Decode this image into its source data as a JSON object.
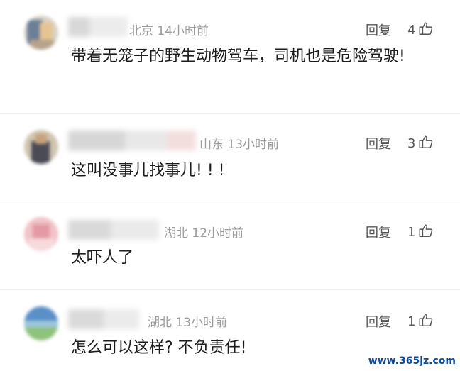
{
  "comments": [
    {
      "location": "北京",
      "time": "14小时前",
      "reply_label": "回复",
      "likes": "4",
      "text": "带着无笼子的野生动物驾车，司机也是危险驾驶!"
    },
    {
      "location": "山东",
      "time": "13小时前",
      "reply_label": "回复",
      "likes": "3",
      "text": "这叫没事儿找事儿! ! !"
    },
    {
      "location": "湖北",
      "time": "12小时前",
      "reply_label": "回复",
      "likes": "1",
      "text": "太吓人了"
    },
    {
      "location": "湖北",
      "time": "13小时前",
      "reply_label": "回复",
      "likes": "1",
      "text": "怎么可以这样? 不负责任!"
    }
  ],
  "watermark": "www.365jz.com",
  "icons": {
    "like": "thumbs-up-icon"
  }
}
